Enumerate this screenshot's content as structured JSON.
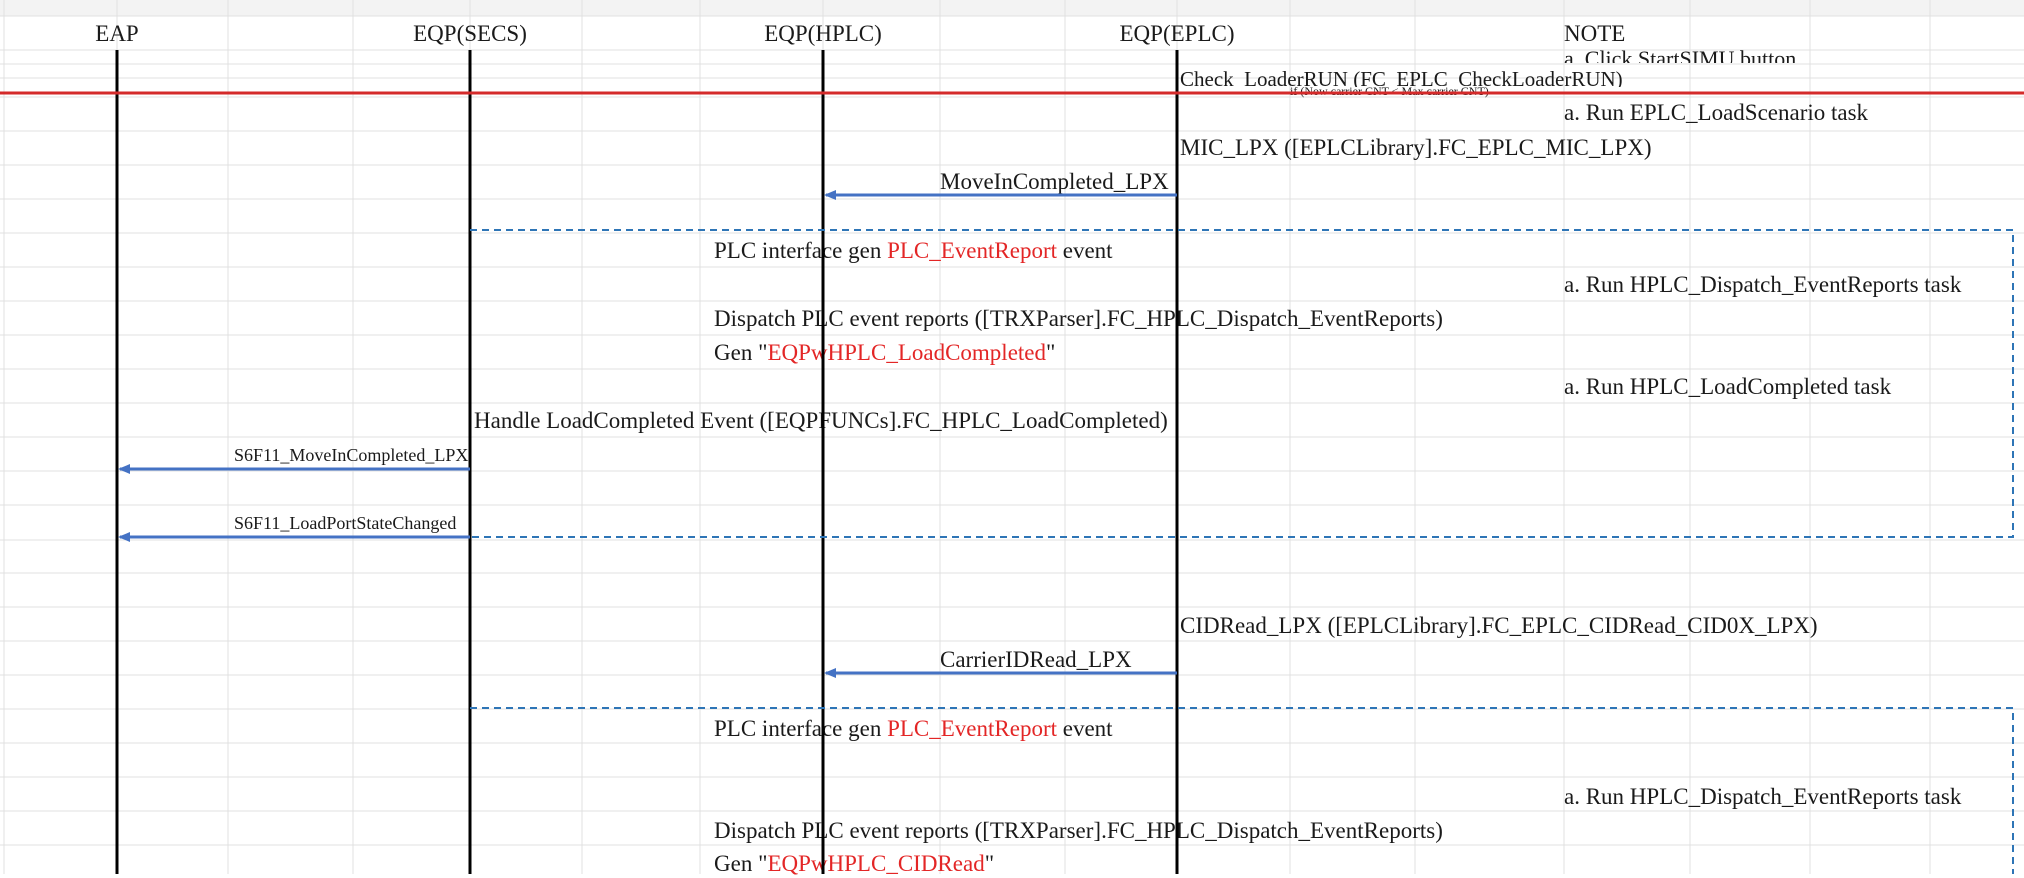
{
  "lanes": [
    "EAP",
    "EQP(SECS)",
    "EQP(HPLC)",
    "EQP(EPLC)"
  ],
  "note_header": "NOTE",
  "top_note": "a. Click StartSIMU button",
  "check_loader": "Check_LoaderRUN (FC_EPLC_CheckLoaderRUN)",
  "condition": "if (Now carrier CNT < Max carrier CNT)",
  "section1": {
    "note_load_scenario": "a. Run EPLC_LoadScenario task",
    "mic_call": "MIC_LPX ([EPLCLibrary].FC_EPLC_MIC_LPX)",
    "msg_move_in": "MoveInCompleted_LPX",
    "plc_gen_prefix": "PLC interface gen ",
    "plc_gen_event": "PLC_EventReport",
    "plc_gen_suffix": " event",
    "note_dispatch": "a. Run HPLC_Dispatch_EventReports task",
    "dispatch": "Dispatch PLC event reports ([TRXParser].FC_HPLC_Dispatch_EventReports)",
    "gen_prefix": "Gen \"",
    "gen_event": "EQPwHPLC_LoadCompleted",
    "gen_suffix": "\"",
    "note_load_completed": "a. Run HPLC_LoadCompleted task",
    "handle": "Handle LoadCompleted Event ([EQPFUNCs].FC_HPLC_LoadCompleted)",
    "s6f11_move_in": "S6F11_MoveInCompleted_LPX",
    "s6f11_port_state": "S6F11_LoadPortStateChanged"
  },
  "section2": {
    "cid_call": "CIDRead_LPX ([EPLCLibrary].FC_EPLC_CIDRead_CID0X_LPX)",
    "msg_carrier": "CarrierIDRead_LPX",
    "plc_gen_prefix": "PLC interface gen ",
    "plc_gen_event": "PLC_EventReport",
    "plc_gen_suffix": " event",
    "note_dispatch": "a. Run HPLC_Dispatch_EventReports task",
    "dispatch": "Dispatch PLC event reports ([TRXParser].FC_HPLC_Dispatch_EventReports)",
    "gen_prefix": "Gen \"",
    "gen_event": "EQPwHPLC_CIDRead",
    "gen_suffix": "\""
  },
  "colors": {
    "arrow": "#4472c4",
    "red_line": "#d42a2a",
    "dashed_box": "#2e75b6",
    "highlight_text": "#e32626",
    "grid": "#dcdcdc"
  }
}
